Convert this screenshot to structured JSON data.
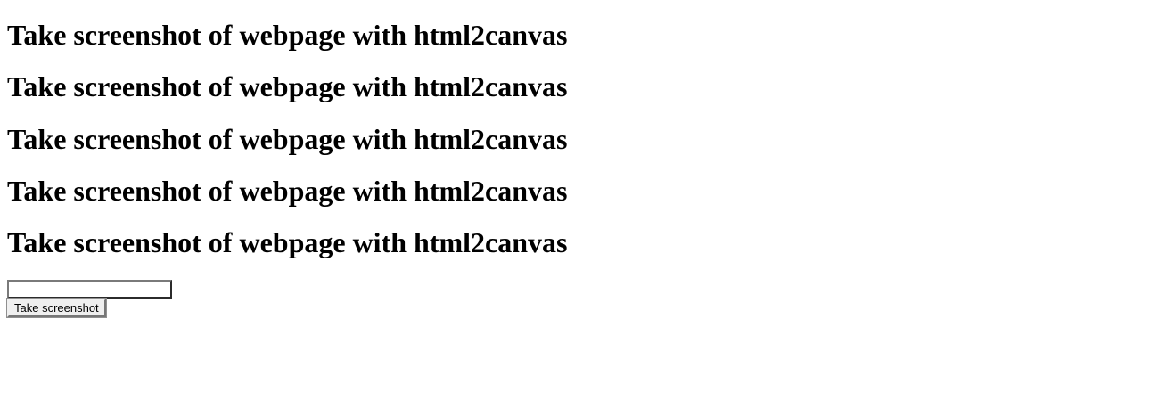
{
  "headings": [
    "Take screenshot of webpage with html2canvas",
    "Take screenshot of webpage with html2canvas",
    "Take screenshot of webpage with html2canvas",
    "Take screenshot of webpage with html2canvas",
    "Take screenshot of webpage with html2canvas"
  ],
  "form": {
    "input_value": "",
    "button_label": "Take screenshot"
  }
}
